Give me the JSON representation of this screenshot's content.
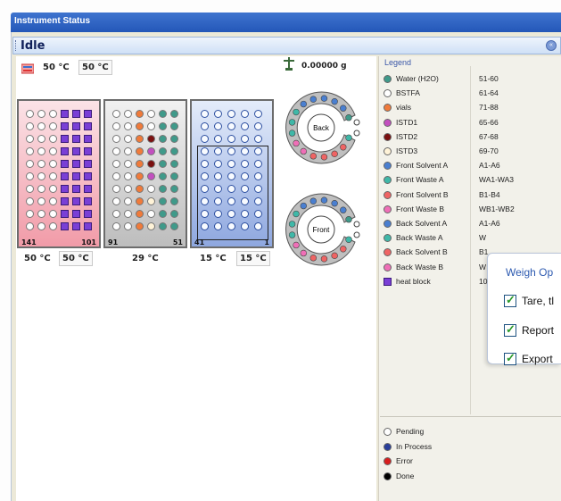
{
  "window": {
    "title": "Instrument Status"
  },
  "status": {
    "text": "Idle"
  },
  "header": {
    "temp_left": "50 °C",
    "temp_box": "50 °C",
    "balance": "0.00000 g"
  },
  "trays": [
    {
      "id": "tray1",
      "corner_left": "141",
      "corner_right": "101",
      "temp_a": "50 °C",
      "temp_b": "50 °C"
    },
    {
      "id": "tray2",
      "corner_left": "91",
      "corner_right": "51",
      "temp_a": "29 °C"
    },
    {
      "id": "tray3",
      "corner_left": "41",
      "corner_right": "1",
      "temp_a": "15 °C",
      "temp_b": "15 °C"
    }
  ],
  "wheels": [
    {
      "label": "Back"
    },
    {
      "label": "Front"
    }
  ],
  "legend": {
    "title": "Legend",
    "items": [
      {
        "name": "Water (H2O)",
        "range": "51-60",
        "color": "#3f9a8a",
        "shape": "dot"
      },
      {
        "name": "BSTFA",
        "range": "61-64",
        "color": "#ffffff",
        "shape": "dot"
      },
      {
        "name": "vials",
        "range": "71-88",
        "color": "#f07a3a",
        "shape": "dot"
      },
      {
        "name": "ISTD1",
        "range": "65-66",
        "color": "#c24fbf",
        "shape": "dot"
      },
      {
        "name": "ISTD2",
        "range": "67-68",
        "color": "#7a1010",
        "shape": "dot"
      },
      {
        "name": "ISTD3",
        "range": "69-70",
        "color": "#fff3d8",
        "shape": "dot"
      },
      {
        "name": "Front Solvent A",
        "range": "A1-A6",
        "color": "#4a7fd0",
        "shape": "dot"
      },
      {
        "name": "Front Waste A",
        "range": "WA1-WA3",
        "color": "#3fb8a8",
        "shape": "dot"
      },
      {
        "name": "Front Solvent B",
        "range": "B1-B4",
        "color": "#ef6464",
        "shape": "dot"
      },
      {
        "name": "Front Waste B",
        "range": "WB1-WB2",
        "color": "#ef6fb7",
        "shape": "dot"
      },
      {
        "name": "Back Solvent A",
        "range": "A1-A6",
        "color": "#4a7fd0",
        "shape": "dot"
      },
      {
        "name": "Back Waste A",
        "range": "W",
        "color": "#3fb8a8",
        "shape": "dot"
      },
      {
        "name": "Back Solvent B",
        "range": "B1",
        "color": "#ef6464",
        "shape": "dot"
      },
      {
        "name": "Back Waste B",
        "range": "W",
        "color": "#ef6fb7",
        "shape": "dot"
      },
      {
        "name": "heat block",
        "range": "10",
        "color": "#7a3fd6",
        "shape": "square"
      }
    ]
  },
  "status_legend": {
    "items": [
      {
        "name": "Pending",
        "color": "#ffffff"
      },
      {
        "name": "In Process",
        "color": "#2a3f9a"
      },
      {
        "name": "Error",
        "color": "#d81e1e"
      },
      {
        "name": "Done",
        "color": "#000000"
      }
    ]
  },
  "weigh_options": {
    "title": "Weigh Op",
    "options": [
      {
        "label": "Tare, tl"
      },
      {
        "label": "Report"
      },
      {
        "label": "Export"
      }
    ]
  }
}
